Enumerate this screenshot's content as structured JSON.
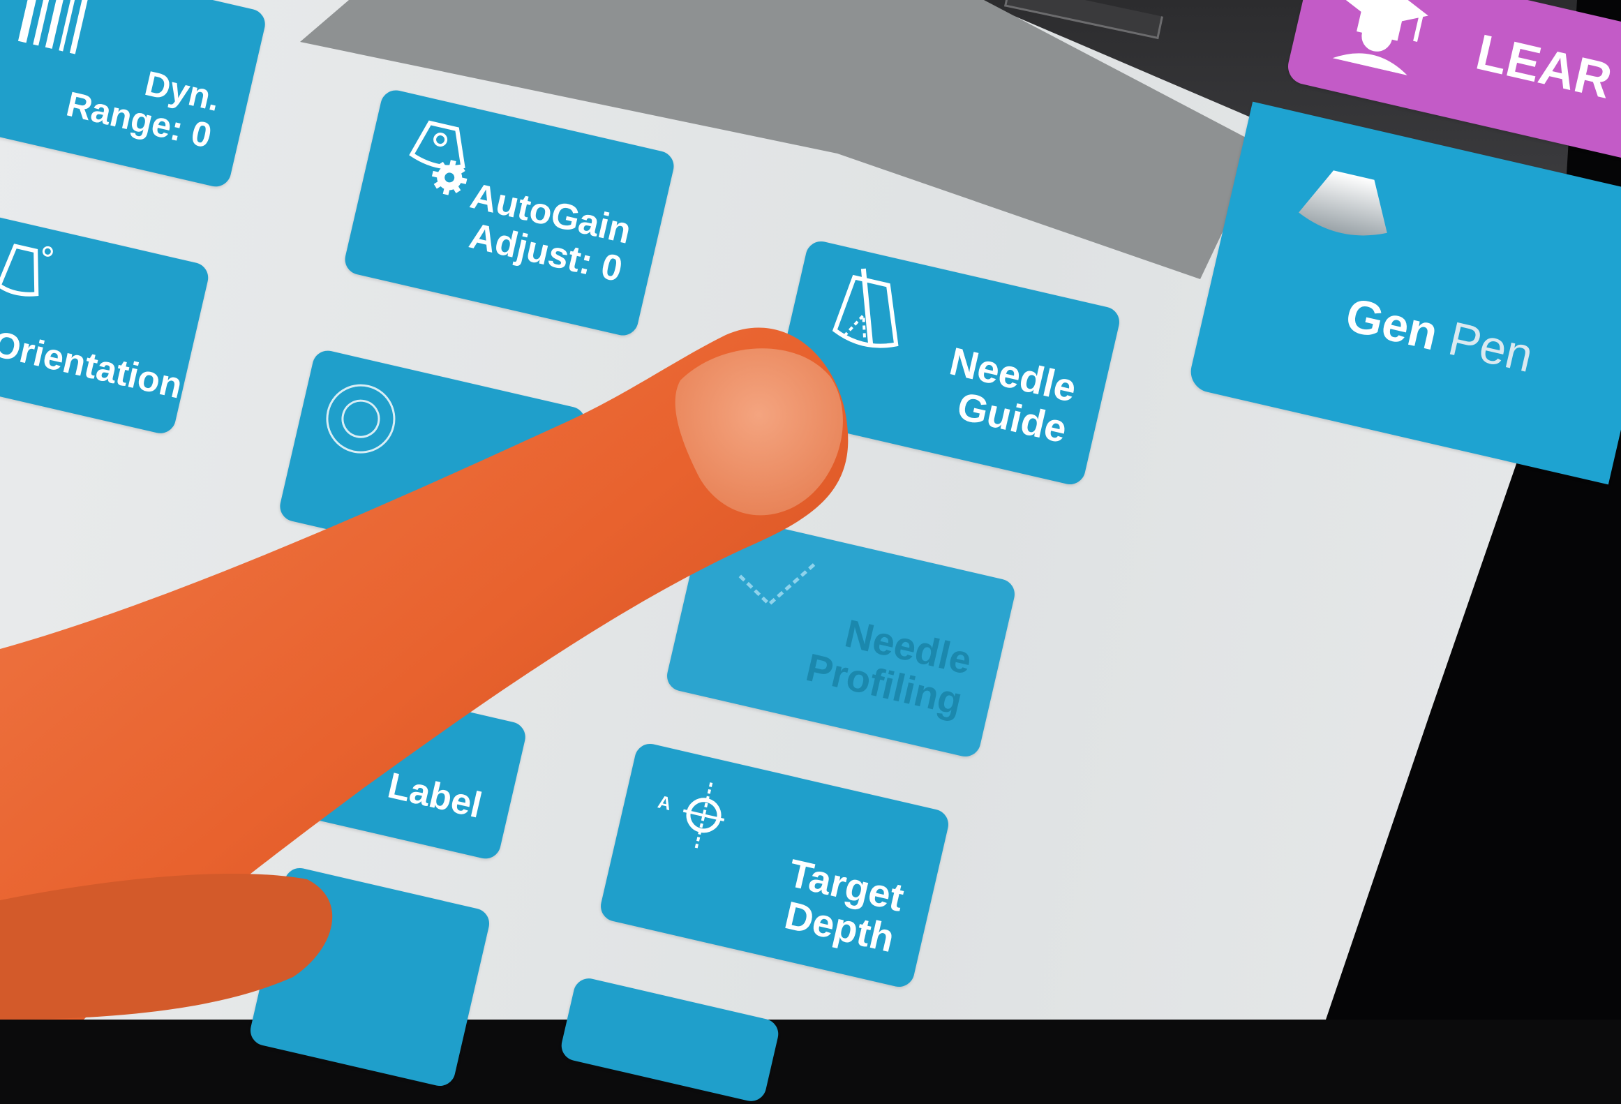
{
  "tiles": {
    "dyn_range": {
      "line1": "Dyn.",
      "line2": "Range: 0"
    },
    "autogain": {
      "line1": "AutoGain",
      "line2": "Adjust: 0"
    },
    "needle_guide": {
      "line1": "Needle",
      "line2": "Guide"
    },
    "needle_profiling": {
      "line1": "Needle",
      "line2": "Profiling"
    },
    "orientation": {
      "label": "Orientation"
    },
    "label": {
      "label": "Label"
    },
    "target_depth": {
      "line1": "Target",
      "line2": "Depth"
    },
    "learn": {
      "label": "LEAR"
    },
    "preset": {
      "word1": "Gen",
      "word2": "Pen"
    }
  },
  "icons": [
    "barcode-icon",
    "autogain-gear-icon",
    "needle-guide-icon",
    "needle-profiling-icon",
    "orientation-icon",
    "target-rings-icon",
    "target-depth-crosshair-icon",
    "graduation-cap-icon",
    "probe-icon"
  ],
  "colors": {
    "tile": "#1f9fcb",
    "learn": "#c35bc7",
    "screen": "#e4e6e7"
  }
}
